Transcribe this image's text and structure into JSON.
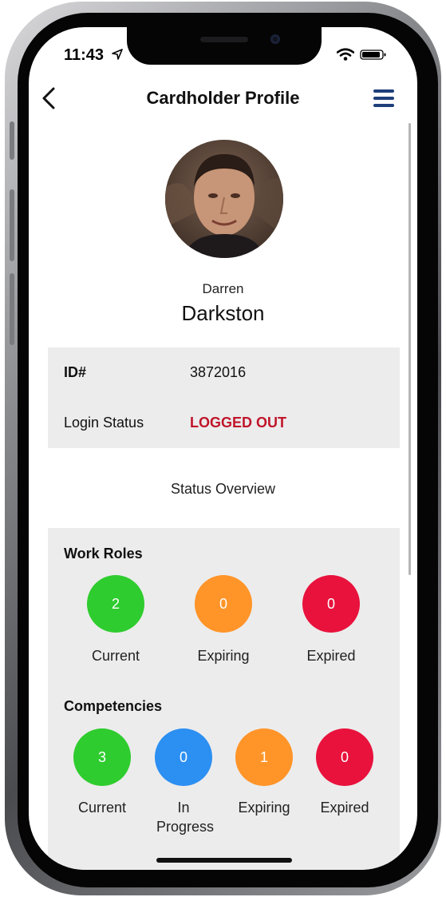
{
  "status_bar": {
    "time": "11:43"
  },
  "nav": {
    "title": "Cardholder Profile"
  },
  "profile": {
    "first_name": "Darren",
    "last_name": "Darkston"
  },
  "info": {
    "id_label": "ID#",
    "id_value": "3872016",
    "login_label": "Login Status",
    "login_value": "LOGGED OUT",
    "login_value_color": "#c0152b"
  },
  "status_overview": "Status Overview",
  "work_roles": {
    "title": "Work Roles",
    "items": [
      {
        "value": "2",
        "label": "Current",
        "color": "#2ecc2e"
      },
      {
        "value": "0",
        "label": "Expiring",
        "color": "#ff9428"
      },
      {
        "value": "0",
        "label": "Expired",
        "color": "#e8123c"
      }
    ]
  },
  "competencies": {
    "title": "Competencies",
    "items": [
      {
        "value": "3",
        "label": "Current",
        "color": "#2ecc2e"
      },
      {
        "value": "0",
        "label": "In Progress",
        "color": "#2c8ff2"
      },
      {
        "value": "1",
        "label": "Expiring",
        "color": "#ff9428"
      },
      {
        "value": "0",
        "label": "Expired",
        "color": "#e8123c"
      }
    ]
  },
  "colors": {
    "nav_menu": "#1f3f7a"
  },
  "icons": [
    "back-chevron-icon",
    "hamburger-menu-icon",
    "location-arrow-icon",
    "wifi-icon",
    "battery-icon"
  ]
}
